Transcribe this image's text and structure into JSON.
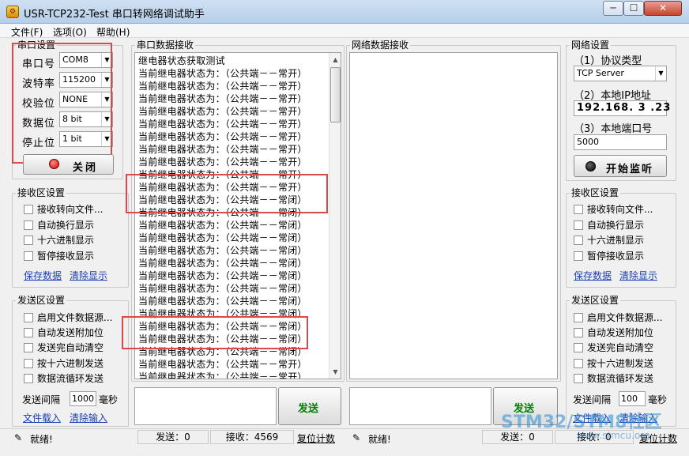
{
  "window": {
    "title": "USR-TCP232-Test 串口转网络调试助手",
    "min_glyph": "─",
    "max_glyph": "☐",
    "close_glyph": "✕"
  },
  "menu": [
    "文件(F)",
    "选项(O)",
    "帮助(H)"
  ],
  "serial_settings": {
    "title": "串口设置",
    "port_label": "串口号",
    "port_value": "COM8",
    "baud_label": "波特率",
    "baud_value": "115200",
    "parity_label": "校验位",
    "parity_value": "NONE",
    "databits_label": "数据位",
    "databits_value": "8 bit",
    "stopbits_label": "停止位",
    "stopbits_value": "1 bit",
    "close_button": "关闭"
  },
  "serial_receive_settings": {
    "title": "接收区设置",
    "options": [
      "接收转向文件...",
      "自动换行显示",
      "十六进制显示",
      "暂停接收显示"
    ],
    "save_link": "保存数据",
    "clear_link": "清除显示"
  },
  "serial_send_settings": {
    "title": "发送区设置",
    "options": [
      "启用文件数据源...",
      "自动发送附加位",
      "发送完自动清空",
      "按十六进制发送",
      "数据流循环发送"
    ],
    "interval_label": "发送间隔",
    "interval_value": "1000",
    "interval_unit": "毫秒",
    "load_link": "文件载入",
    "clear_link": "清除输入"
  },
  "serial_receive": {
    "title": "串口数据接收",
    "lines": [
      "继电器状态获取测试",
      "当前继电器状态为：（公共端－－常开）",
      "当前继电器状态为：（公共端－－常开）",
      "当前继电器状态为：（公共端－－常开）",
      "当前继电器状态为：（公共端－－常开）",
      "当前继电器状态为：（公共端－－常开）",
      "当前继电器状态为：（公共端－－常开）",
      "当前继电器状态为：（公共端－－常开）",
      "当前继电器状态为：（公共端－－常开）",
      "当前继电器状态为：（公共端－－常开）",
      "当前继电器状态为：（公共端－－常开）",
      "当前继电器状态为：（公共端－－常闭）",
      "当前继电器状态为：（公共端－－常闭）",
      "当前继电器状态为：（公共端－－常闭）",
      "当前继电器状态为：（公共端－－常闭）",
      "当前继电器状态为：（公共端－－常闭）",
      "当前继电器状态为：（公共端－－常闭）",
      "当前继电器状态为：（公共端－－常闭）",
      "当前继电器状态为：（公共端－－常闭）",
      "当前继电器状态为：（公共端－－常闭）",
      "当前继电器状态为：（公共端－－常闭）",
      "当前继电器状态为：（公共端－－常闭）",
      "当前继电器状态为：（公共端－－常闭）",
      "当前继电器状态为：（公共端－－常闭）",
      "当前继电器状态为：（公共端－－常开）",
      "当前继电器状态为：（公共端－－常开）",
      "当前继电器状态为：（公共端－－常？",
      "当前继电器状态为：（公共端－－常开）"
    ]
  },
  "network_receive": {
    "title": "网络数据接收"
  },
  "network_settings": {
    "title": "网络设置",
    "protocol_label": "（1）协议类型",
    "protocol_value": "TCP Server",
    "ip_label": "（2）本地IP地址",
    "ip_value": "192.168. 3 .23",
    "port_label": "（3）本地端口号",
    "port_value": "5000",
    "listen_button": "开始监听"
  },
  "network_receive_settings": {
    "title": "接收区设置",
    "options": [
      "接收转向文件...",
      "自动换行显示",
      "十六进制显示",
      "暂停接收显示"
    ],
    "save_link": "保存数据",
    "clear_link": "清除显示"
  },
  "network_send_settings": {
    "title": "发送区设置",
    "options": [
      "启用文件数据源...",
      "自动发送附加位",
      "发送完自动清空",
      "按十六进制发送",
      "数据流循环发送"
    ],
    "interval_label": "发送间隔",
    "interval_value": "100",
    "interval_unit": "毫秒",
    "load_link": "文件载入",
    "clear_link": "清除输入"
  },
  "send_button_label": "发送",
  "status_left": {
    "ready": "就绪!",
    "sent": "发送：0",
    "received": "接收：4569",
    "reset": "复位计数"
  },
  "status_right": {
    "ready": "就绪!",
    "sent": "发送：0",
    "received": "接收：0",
    "reset": "复位计数"
  },
  "watermark": {
    "text": "STM32/STM8社区",
    "url": "www.stmcu.org"
  },
  "colors": {
    "highlight_box": "#d94a4a",
    "send_button_text": "#008000",
    "link": "#1c3fb3"
  }
}
